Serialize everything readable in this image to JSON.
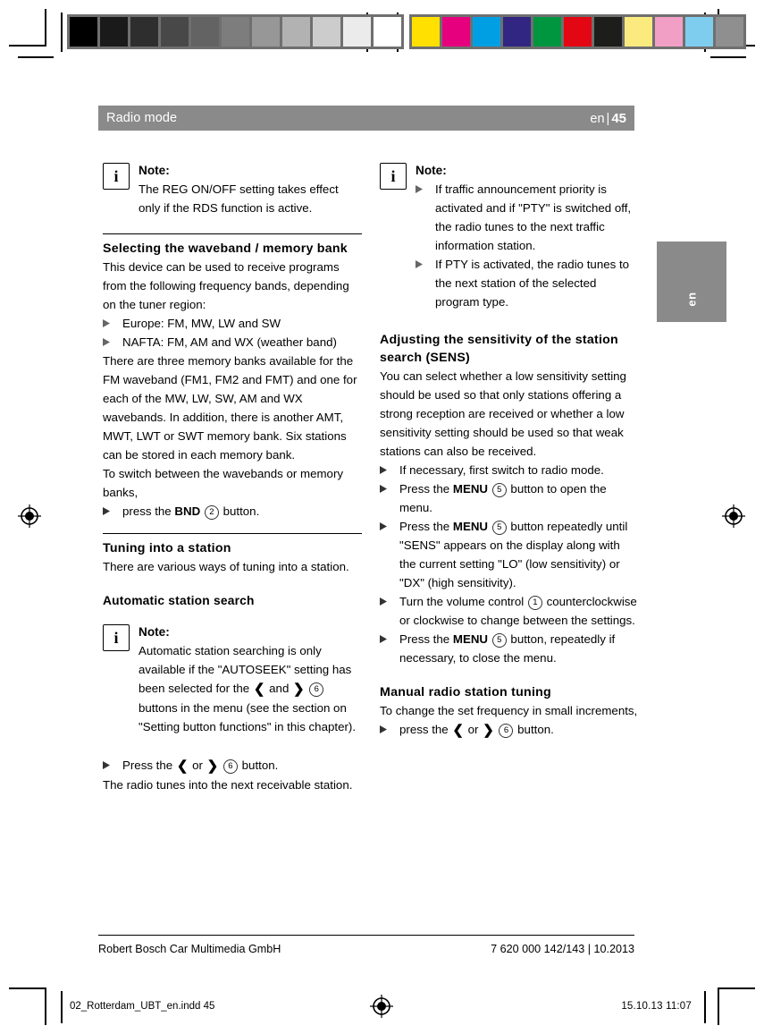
{
  "header": {
    "title": "Radio mode",
    "lang": "en",
    "separator": "|",
    "page_number": "45"
  },
  "side_tab": {
    "label": "en"
  },
  "calibration": {
    "grayscale_label": "grayscale-strip",
    "grayscale": [
      "#000000",
      "#1a1a1a",
      "#2e2e2e",
      "#484848",
      "#636363",
      "#7d7d7d",
      "#979797",
      "#b2b2b2",
      "#cccccc",
      "#ebebeb",
      "#ffffff"
    ],
    "color_label": "color-strip",
    "colors": [
      "#ffe000",
      "#e6007e",
      "#009fe3",
      "#312783",
      "#009640",
      "#e30613",
      "#1d1d1b",
      "#fbeb7f",
      "#f29fc5",
      "#7fcdee",
      "#8f8f8f"
    ]
  },
  "left_column": {
    "note_1": {
      "icon": "info-icon",
      "icon_glyph": "i",
      "title": "Note:",
      "body": "The REG ON/OFF setting takes effect only if the RDS function is active."
    },
    "section_1": {
      "heading": "Selecting the waveband / memory bank",
      "para_1": "This device can be used to receive programs from the following frequency bands, depending on the tuner region:",
      "bullets": [
        "Europe:  FM, MW, LW and SW",
        "NAFTA: FM, AM and WX (weather band)"
      ],
      "para_2": "There are three memory banks available for the FM waveband (FM1, FM2 and FMT) and one for each of the MW, LW, SW, AM and WX wavebands. In addition, there is another AMT, MWT, LWT or SWT memory bank. Six stations can be stored in each memory bank.",
      "para_3": "To switch between the wavebands or memory banks,",
      "bullet_action": {
        "pre": "press the ",
        "button": "BND",
        "num": "2",
        "post": " button."
      }
    },
    "section_2": {
      "heading": "Tuning into a station",
      "para_1": "There are various ways of tuning into a station.",
      "sub_heading": "Automatic station search",
      "note_2": {
        "icon": "info-icon",
        "icon_glyph": "i",
        "title": "Note:",
        "body_part_1": "Automatic station searching is only available if the \"AUTOSEEK\" setting has been selected for the ",
        "arrow_left": "❮",
        "and": " and ",
        "arrow_right": "❯",
        "num": "6",
        "body_part_2": " buttons in the menu (see the section on \"Setting button functions\" in this chapter)."
      },
      "bullet_action": {
        "pre": "Press the ",
        "arrow_left": "❮",
        "or": " or ",
        "arrow_right": "❯",
        "num": "6",
        "post": " button."
      },
      "para_2": "The radio tunes into the next receivable station."
    }
  },
  "right_column": {
    "note_1": {
      "icon": "info-icon",
      "icon_glyph": "i",
      "title": "Note:",
      "bullets": [
        "If traffic announcement priority is activated and if \"PTY\" is switched off, the radio tunes to the next traffic information station.",
        "If PTY is activated, the radio tunes to the next station of the selected program type."
      ]
    },
    "section_1": {
      "heading": "Adjusting the sensitivity of the station search (SENS)",
      "para_1": "You can select whether a low sensitivity setting should be used so that only stations offering a strong reception are received or whether a low sensitivity setting should be used so that weak stations can also be received.",
      "bullet_1": "If necessary, first switch to radio mode.",
      "bullet_2": {
        "pre": "Press the ",
        "button": "MENU",
        "num": "5",
        "post": " button to open the menu."
      },
      "bullet_3": {
        "pre": "Press the  ",
        "button": "MENU",
        "num": "5",
        "post": " button repeatedly until \"SENS\" appears on the display along with the current setting \"LO\" (low sensitivity) or \"DX\" (high sensitivity)."
      },
      "bullet_4": {
        "pre": "Turn the volume control ",
        "num": "1",
        "post": " counterclockwise or clockwise to change between the settings."
      },
      "bullet_5": {
        "pre": "Press the ",
        "button": "MENU",
        "num": "5",
        "post": " button, repeatedly if necessary, to close the menu."
      }
    },
    "section_2": {
      "heading": "Manual radio station tuning",
      "para_1": "To change the set frequency in small increments,",
      "bullet_action": {
        "pre": "press the ",
        "arrow_left": "❮",
        "or": " or ",
        "arrow_right": "❯",
        "num": "6",
        "post": " button."
      }
    }
  },
  "footer": {
    "company": "Robert Bosch Car Multimedia GmbH",
    "doc_ref": "7 620 000 142/143 | 10.2013"
  },
  "slug": {
    "filename": "02_Rotterdam_UBT_en.indd   45",
    "timestamp": "15.10.13   11:07"
  }
}
